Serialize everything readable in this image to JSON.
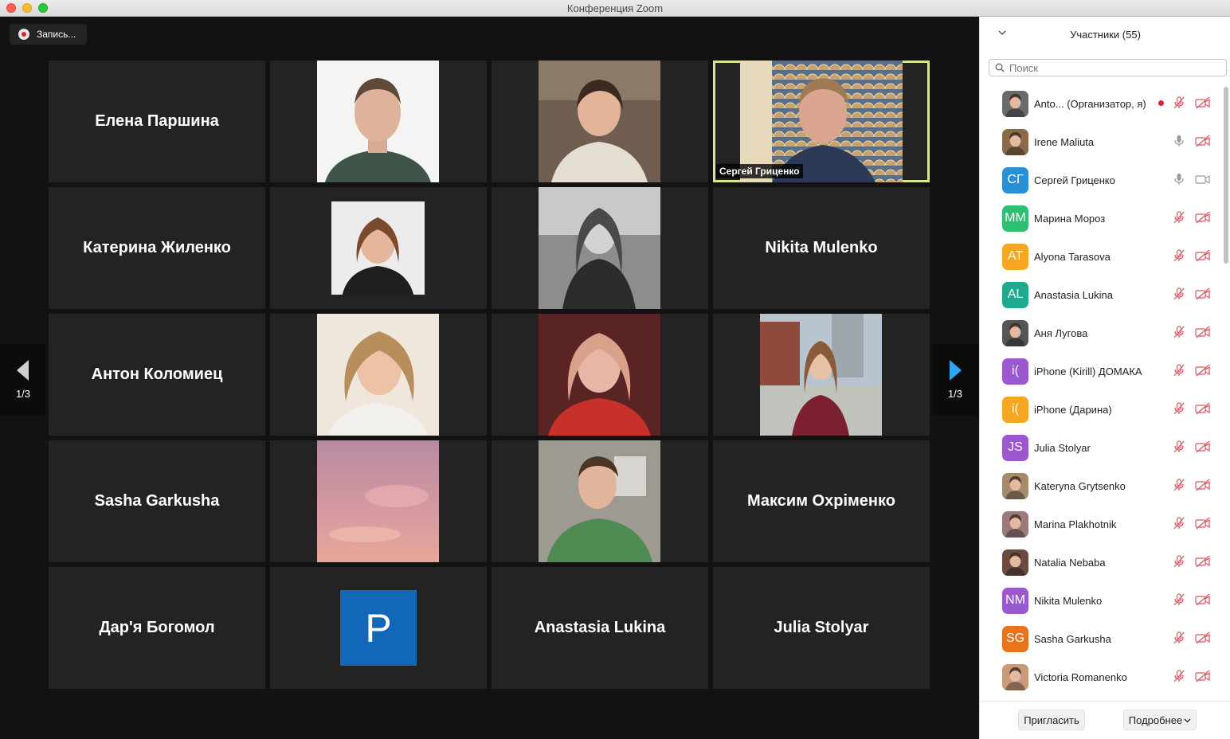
{
  "window": {
    "title": "Конференция Zoom"
  },
  "toolbar": {
    "record_label": "Запись..."
  },
  "gallery": {
    "page_left": "1/3",
    "page_right": "1/3",
    "tiles": [
      {
        "name": "Елена Паршина"
      },
      {
        "name": "Катерина Жиленко"
      },
      {
        "name": "Антон Коломиец"
      },
      {
        "name": "Sasha Garkusha"
      },
      {
        "name": "Дар'я Богомол"
      },
      {
        "name": "Nikita Mulenko"
      },
      {
        "name": "Максим Охріменко"
      },
      {
        "name": "Anastasia Lukina"
      },
      {
        "name": "Julia Stolyar"
      },
      {
        "name": "Сергей Гриценко"
      },
      {
        "initial": "P"
      }
    ]
  },
  "participants": {
    "title": "Участники (55)",
    "search_placeholder": "Поиск",
    "items": [
      {
        "name": "Anto... (Организатор, я)",
        "avatar": "photo",
        "color": "#6a6a6a"
      },
      {
        "name": "Irene Maliuta",
        "avatar": "photo",
        "color": "#8a6a4a"
      },
      {
        "name": "Сергей Гриценко",
        "initials": "СГ",
        "color": "#2b8fd6"
      },
      {
        "name": "Марина Мороз",
        "initials": "ММ",
        "color": "#2fbf71"
      },
      {
        "name": "Alyona Tarasova",
        "initials": "AT",
        "color": "#f5a623"
      },
      {
        "name": "Anastasia Lukina",
        "initials": "AL",
        "color": "#1fa98f"
      },
      {
        "name": "Аня Лугова",
        "avatar": "photo",
        "color": "#555555"
      },
      {
        "name": "iPhone (Kirill) ДОМАКА",
        "initials": "i(",
        "color": "#9b59d0"
      },
      {
        "name": "iPhone (Дарина)",
        "initials": "i(",
        "color": "#f5a623"
      },
      {
        "name": "Julia Stolyar",
        "initials": "JS",
        "color": "#9b59d0"
      },
      {
        "name": "Kateryna Grytsenko",
        "avatar": "photo",
        "color": "#a58b6c"
      },
      {
        "name": "Marina Plakhotnik",
        "avatar": "photo",
        "color": "#9a7b7b"
      },
      {
        "name": "Natalia Nebaba",
        "avatar": "photo",
        "color": "#6d4a3f"
      },
      {
        "name": "Nikita Mulenko",
        "initials": "NM",
        "color": "#9b59d0"
      },
      {
        "name": "Sasha Garkusha",
        "initials": "SG",
        "color": "#e8741c"
      },
      {
        "name": "Victoria Romanenko",
        "avatar": "photo",
        "color": "#c79a7a"
      }
    ]
  },
  "footer": {
    "invite_label": "Пригласить",
    "more_label": "Подробнее"
  }
}
